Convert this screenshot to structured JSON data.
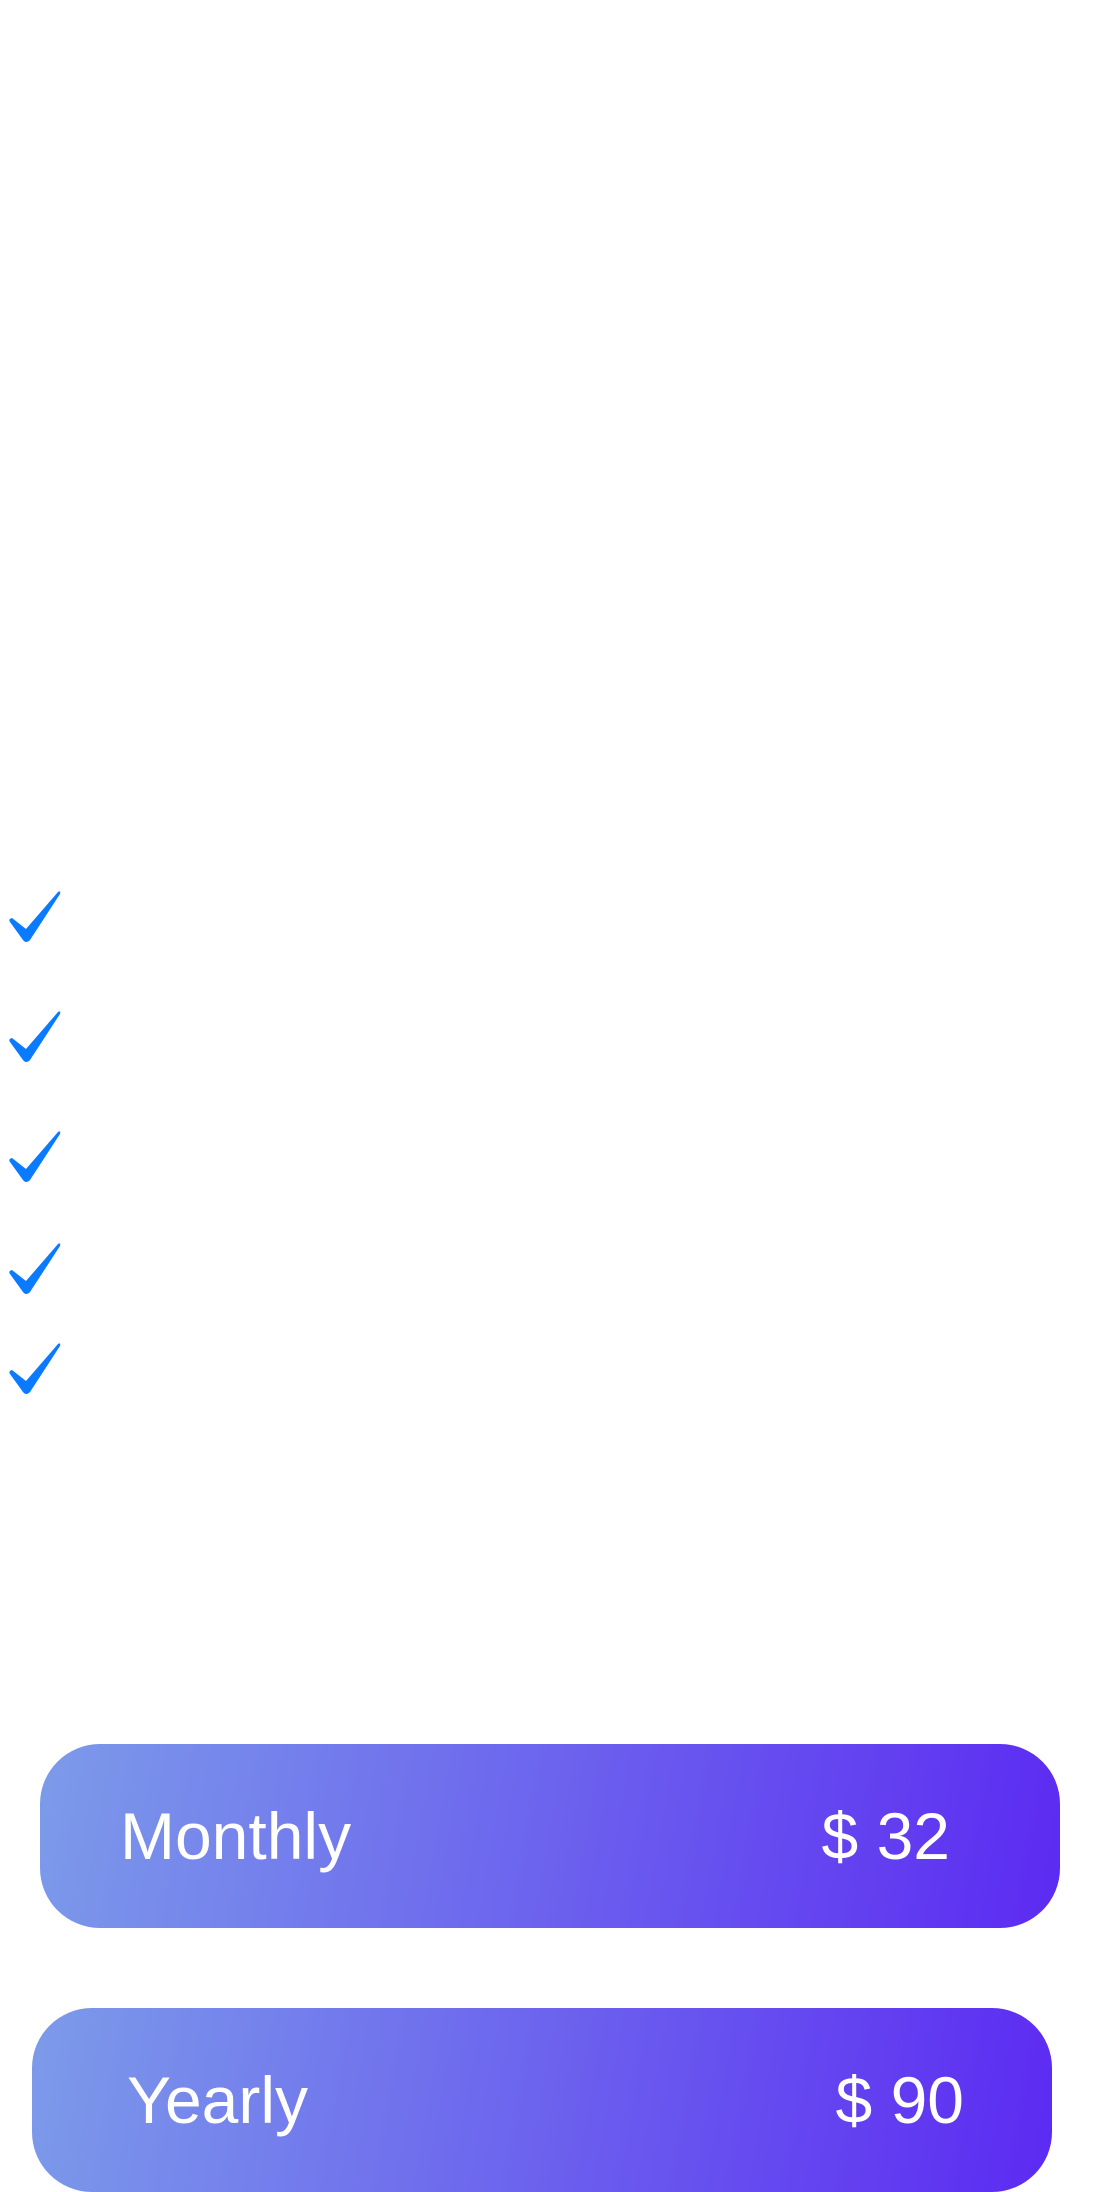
{
  "features": {
    "check_icon": "checkmark-icon",
    "check_color": "#0A7AFF",
    "items": [
      "",
      "",
      "",
      "",
      ""
    ]
  },
  "plans": [
    {
      "id": "monthly",
      "name": "Monthly",
      "price": "$ 32"
    },
    {
      "id": "yearly",
      "name": "Yearly",
      "price": "$ 90"
    }
  ],
  "colors": {
    "background": "#FFFFFF",
    "plan_gradient_start": "#7C9BEA",
    "plan_gradient_end": "#5C2AF2",
    "plan_text": "#FFFFFF"
  }
}
